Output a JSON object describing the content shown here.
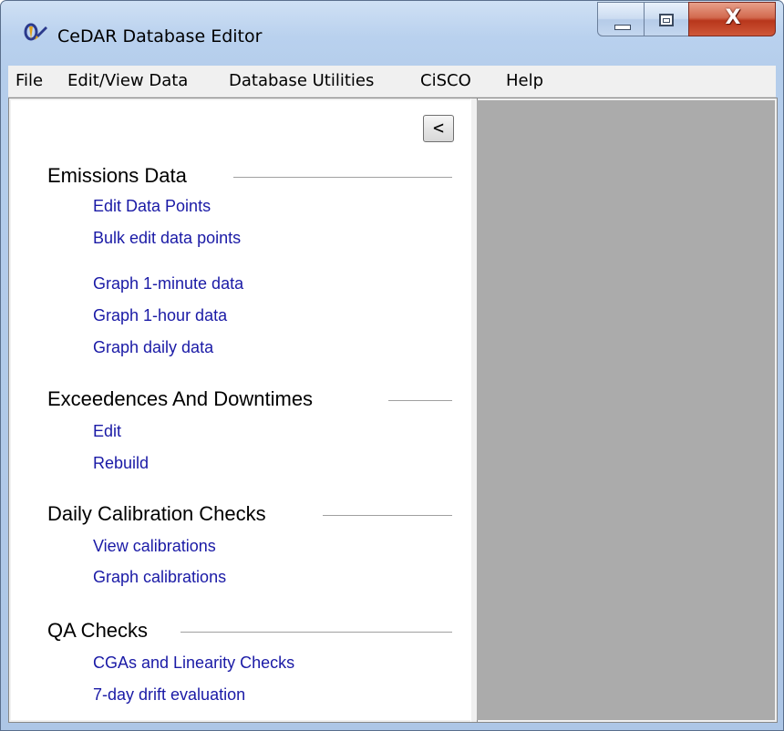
{
  "window": {
    "title": "CeDAR Database Editor",
    "icon": "cedar-app-icon",
    "controls": {
      "minimize_icon": "minimize-icon",
      "maximize_icon": "maximize-icon",
      "close_label": "X"
    }
  },
  "menu": {
    "items": [
      {
        "label": "File"
      },
      {
        "label": "Edit/View Data"
      },
      {
        "label": "Database Utilities"
      },
      {
        "label": "CiSCO"
      },
      {
        "label": "Help"
      }
    ]
  },
  "panel": {
    "collapse_label": "<",
    "sections": [
      {
        "title": "Emissions Data",
        "links": [
          {
            "label": "Edit Data Points"
          },
          {
            "label": "Bulk edit data points"
          },
          {
            "label": "Graph 1-minute data"
          },
          {
            "label": "Graph 1-hour data"
          },
          {
            "label": "Graph daily data"
          }
        ]
      },
      {
        "title": "Exceedences And Downtimes",
        "links": [
          {
            "label": "Edit"
          },
          {
            "label": "Rebuild"
          }
        ]
      },
      {
        "title": "Daily Calibration Checks",
        "links": [
          {
            "label": "View calibrations"
          },
          {
            "label": "Graph calibrations"
          }
        ]
      },
      {
        "title": "QA Checks",
        "links": [
          {
            "label": "CGAs and Linearity Checks"
          },
          {
            "label": "7-day drift evaluation"
          }
        ]
      }
    ]
  },
  "colors": {
    "link": "#1a1aa6",
    "right_panel": "#ababab",
    "menubar": "#f0f0f0",
    "titlebar": "#b9d1ee",
    "close_button": "#c7432a"
  }
}
